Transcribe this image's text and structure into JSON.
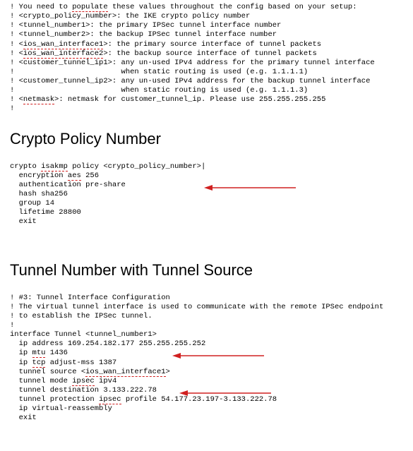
{
  "intro_block": {
    "lines": [
      {
        "prefix": "! You need to ",
        "u": "populate",
        "rest": " these values throughout the config based on your setup:"
      },
      {
        "prefix": "! <crypto_policy_number>: the IKE crypto policy number"
      },
      {
        "prefix": "! <tunnel_number1>: the primary IPSec tunnel interface number"
      },
      {
        "prefix": "! <tunnel_number2>: the backup IPSec tunnel interface number"
      },
      {
        "prefix": "! <",
        "u": "ios_wan_interface1",
        "rest": ">: the primary source interface of tunnel packets"
      },
      {
        "prefix": "! <",
        "u": "ios_wan_interface2",
        "rest": ">: the backup source interface of tunnel packets"
      },
      {
        "prefix": "! <customer_tunnel_ip1>: any un-used IPv4 address for the primary tunnel interface"
      },
      {
        "prefix": "!                        when static routing is used (e.g. 1.1.1.1)"
      },
      {
        "prefix": "! <customer_tunnel_ip2>: any un-used IPv4 address for the backup tunnel interface"
      },
      {
        "prefix": "!                        when static routing is used (e.g. 1.1.1.3)"
      },
      {
        "prefix": "! <",
        "u": "netmask",
        "rest": ">: netmask for customer_tunnel_ip. Please use 255.255.255.255"
      },
      {
        "prefix": "!"
      }
    ]
  },
  "heading1": "Crypto Policy Number",
  "crypto_block": {
    "lines": [
      {
        "segs": [
          {
            "t": "crypto "
          },
          {
            "t": "isakmp",
            "u": true
          },
          {
            "t": " policy <crypto_policy_number>|"
          }
        ]
      },
      {
        "segs": [
          {
            "t": "  encryption "
          },
          {
            "t": "aes",
            "u": true
          },
          {
            "t": " 256"
          }
        ]
      },
      {
        "segs": [
          {
            "t": "  authentication pre-share"
          }
        ]
      },
      {
        "segs": [
          {
            "t": "  hash sha256"
          }
        ]
      },
      {
        "segs": [
          {
            "t": "  group 14"
          }
        ]
      },
      {
        "segs": [
          {
            "t": "  lifetime 28800"
          }
        ]
      },
      {
        "segs": [
          {
            "t": "  exit"
          }
        ]
      }
    ]
  },
  "heading2": "Tunnel Number with Tunnel Source",
  "tunnel_block": {
    "lines": [
      {
        "segs": [
          {
            "t": "! #3: Tunnel Interface Configuration"
          }
        ]
      },
      {
        "segs": [
          {
            "t": "! The virtual tunnel interface is used to communicate with the remote IPSec endpoint"
          }
        ]
      },
      {
        "segs": [
          {
            "t": "! to establish the IPSec tunnel."
          }
        ]
      },
      {
        "segs": [
          {
            "t": "!"
          }
        ]
      },
      {
        "segs": [
          {
            "t": "interface Tunnel <tunnel_number1>"
          }
        ]
      },
      {
        "segs": [
          {
            "t": "  ip address 169.254.182.177 255.255.255.252"
          }
        ]
      },
      {
        "segs": [
          {
            "t": "  ip "
          },
          {
            "t": "mtu",
            "u": true
          },
          {
            "t": " 1436"
          }
        ]
      },
      {
        "segs": [
          {
            "t": "  ip "
          },
          {
            "t": "tcp",
            "u": true
          },
          {
            "t": " adjust-mss 1387"
          }
        ]
      },
      {
        "segs": [
          {
            "t": "  tunnel source <"
          },
          {
            "t": "ios_wan_interface1",
            "u": true
          },
          {
            "t": ">"
          }
        ]
      },
      {
        "segs": [
          {
            "t": "  tunnel mode "
          },
          {
            "t": "ipsec",
            "u": true
          },
          {
            "t": " ipv4"
          }
        ]
      },
      {
        "segs": [
          {
            "t": "  tunnel destination 3.133.222.78"
          }
        ]
      },
      {
        "segs": [
          {
            "t": "  tunnel protection "
          },
          {
            "t": "ipsec",
            "u": true
          },
          {
            "t": " profile 54.177.23.197-3.133.222.78"
          }
        ]
      },
      {
        "segs": [
          {
            "t": "  ip virtual-reassembly"
          }
        ]
      },
      {
        "segs": [
          {
            "t": "  exit"
          }
        ]
      }
    ]
  },
  "arrow_color": "#d02020"
}
